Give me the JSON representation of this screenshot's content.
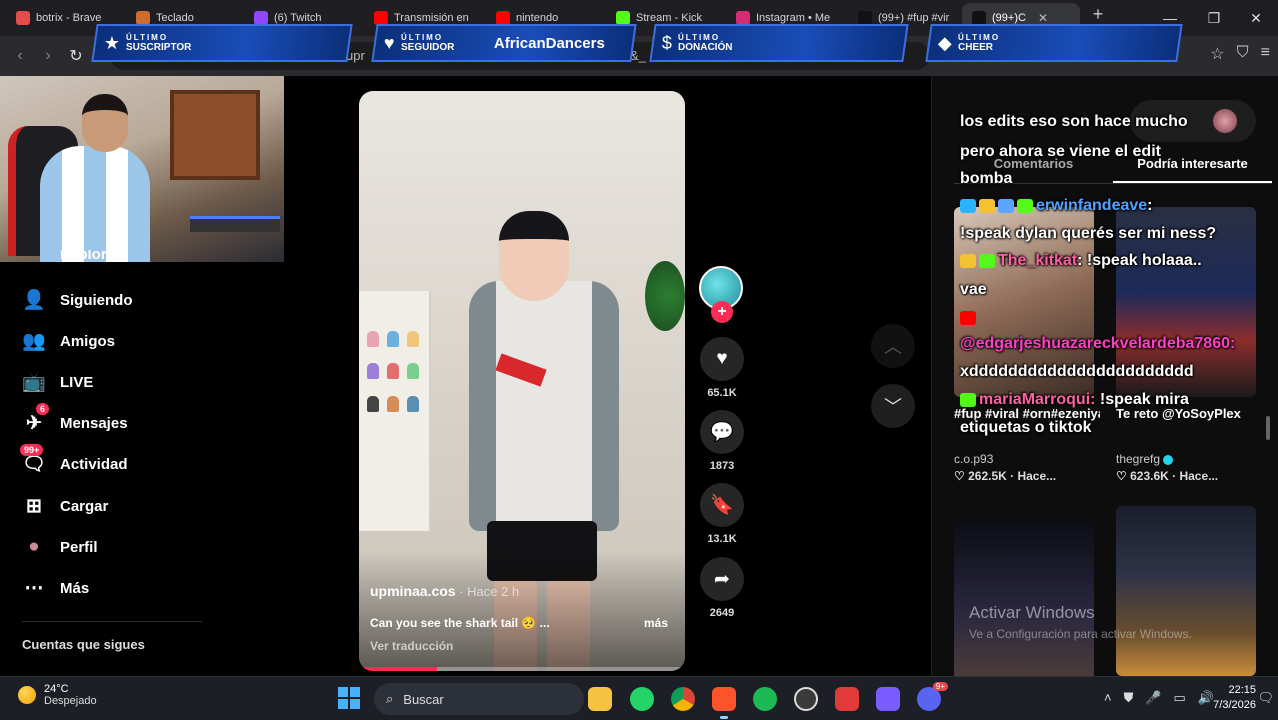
{
  "browser": {
    "tabs": [
      {
        "label": "botrix - Brave",
        "color": "#e44b4b",
        "width": 118
      },
      {
        "label": "Teclado",
        "color": "#cf6b2b",
        "width": 116
      },
      {
        "label": "(6) Twitch",
        "color": "#9146ff",
        "width": 118
      },
      {
        "label": "Transmisión en",
        "color": "#ff0000",
        "width": 120
      },
      {
        "label": "nintendo",
        "color": "#ff0000",
        "width": 118
      },
      {
        "label": "Stream - Kick",
        "color": "#53fc18",
        "width": 118
      },
      {
        "label": "Instagram • Me",
        "color": "#d62976",
        "width": 120
      },
      {
        "label": "(99+) #fup #vir",
        "color": "#111111",
        "width": 112
      },
      {
        "label": "(99+)C",
        "color": "#111111",
        "width": 118
      }
    ],
    "address_text": "upr",
    "address_text_2": "&_"
  },
  "overlay": {
    "sub_small": "ÚLTIMO",
    "sub_big": "SUSCRIPTOR",
    "follower_small": "ÚLTIMO",
    "follower_big": "SEGUIDOR",
    "follower_name": "AfricanDancers",
    "donation_small": "ÚLTIMO",
    "donation_big": "DONACIÓN",
    "cheer_small": "ÚLTIMO",
    "cheer_big": "CHEER"
  },
  "nav": {
    "explore_partial": "Explorar",
    "items": [
      {
        "label": "Siguiendo",
        "icon": "following-icon",
        "badge": ""
      },
      {
        "label": "Amigos",
        "icon": "friends-icon",
        "badge": ""
      },
      {
        "label": "LIVE",
        "icon": "live-icon",
        "badge": ""
      },
      {
        "label": "Mensajes",
        "icon": "messages-icon",
        "badge": "6"
      },
      {
        "label": "Actividad",
        "icon": "activity-icon",
        "badge": "99+"
      },
      {
        "label": "Cargar",
        "icon": "upload-icon",
        "badge": ""
      },
      {
        "label": "Perfil",
        "icon": "profile-icon",
        "badge": ""
      },
      {
        "label": "Más",
        "icon": "more-icon",
        "badge": ""
      }
    ],
    "following_header": "Cuentas que sigues"
  },
  "video": {
    "author": "upminaa.cos",
    "time": " · Hace 2 h",
    "description": "Can you see the shark tail 🥺 ...",
    "more": "más",
    "translate": "Ver traducción",
    "progress": 0.24
  },
  "actions": {
    "likes": "65.1K",
    "comments": "1873",
    "saves": "13.1K",
    "shares": "2649"
  },
  "right_panel": {
    "tab_comments": "Comentarios",
    "tab_interest": "Podría interesarte",
    "cards": [
      {
        "title": "#fup #viral #orn#ezeniyaco...",
        "user": "c.o.p93",
        "stats": "262.5K · Hace...",
        "verified": false
      },
      {
        "title": "Te reto @YoSoyPlex",
        "user": "thegrefg",
        "stats": "623.6K · Hace...",
        "verified": true
      }
    ]
  },
  "chat": {
    "line1": "los edits eso son hace mucho",
    "line2": "pero ahora se viene el edit",
    "line3": "bomba",
    "user1": "erwinfandeave",
    "msg1a": "!speak dylan querés ser mi ness?",
    "user2": "The_kitkat",
    "msg2a": " !speak holaaa..",
    "msg2b": "vae",
    "user3": "@edgarjeshuazareckvelardeba7860:",
    "msg3": "xddddddddddddddddddddddd",
    "user4": "mariaMarroqui:",
    "msg4a": " !speak mira",
    "msg4b": "etiquetas o tiktok"
  },
  "watermark": {
    "title": "Activar Windows",
    "subtitle": "Ve a Configuración para activar Windows."
  },
  "taskbar": {
    "temp": "24°C",
    "weather": "Despejado",
    "search_placeholder": "Buscar",
    "time": "22:15",
    "date": "7/3/2026",
    "discord_badge": "9+"
  }
}
